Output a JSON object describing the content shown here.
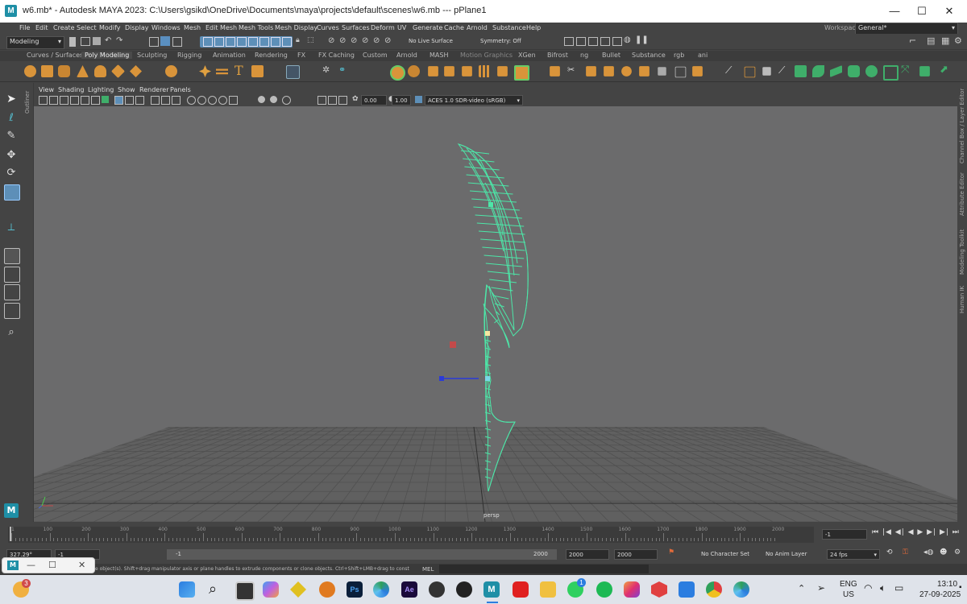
{
  "window": {
    "title": "w6.mb* - Autodesk MAYA 2023: C:\\Users\\gsikd\\OneDrive\\Documents\\maya\\projects\\default\\scenes\\w6.mb   ---   pPlane1",
    "logo": "M",
    "minimize": "—",
    "maximize": "☐",
    "close": "✕"
  },
  "menus": [
    "File",
    "Edit",
    "Create",
    "Select",
    "Modify",
    "Display",
    "Windows",
    "Mesh",
    "Edit Mesh",
    "Mesh Tools",
    "Mesh Display",
    "Curves",
    "Surfaces",
    "Deform",
    "UV",
    "Generate",
    "Cache",
    "Arnold",
    "Substance",
    "Help"
  ],
  "workspace": {
    "label": "Workspace:",
    "value": "General*"
  },
  "status": {
    "mode": "Modeling",
    "live_surface": "No Live Surface",
    "symmetry": "Symmetry: Off"
  },
  "shelf_tabs": [
    "Curves / Surfaces",
    "Poly Modeling",
    "Sculpting",
    "Rigging",
    "Animation",
    "Rendering",
    "FX",
    "FX Caching",
    "Custom",
    "Arnold",
    "MASH",
    "Motion Graphics",
    "XGen",
    "Bifrost",
    "ng",
    "Bullet",
    "Substance",
    "rgb",
    "ani"
  ],
  "active_shelf_tab": "Poly Modeling",
  "panel_menus": [
    "View",
    "Shading",
    "Lighting",
    "Show",
    "Renderer",
    "Panels"
  ],
  "panel_fields": {
    "exposure": "0.00",
    "gamma": "1.00",
    "colorspace": "ACES 1.0 SDR-video (sRGB)"
  },
  "viewport": {
    "camera_label": "persp"
  },
  "side_labels": {
    "left": "Outliner",
    "right": [
      "Channel Box / Layer Editor",
      "Attribute Editor",
      "Modeling Toolkit",
      "Human IK"
    ]
  },
  "timeline": {
    "ticks": [
      "1",
      "100",
      "200",
      "300",
      "400",
      "500",
      "600",
      "700",
      "800",
      "900",
      "1000",
      "1100",
      "1200",
      "1300",
      "1400",
      "1500",
      "1600",
      "1700",
      "1800",
      "1900",
      "2000"
    ],
    "current_frame": "-1",
    "range_start": "327.29°",
    "range_field": "-1",
    "slider_start": "-1",
    "slider_end": "2000",
    "end1": "2000",
    "end2": "2000",
    "character_set": "No Character Set",
    "anim_layer": "No Anim Layer",
    "fps": "24 fps"
  },
  "helpline": {
    "text": "e object(s). Shift+drag manipulator axis or plane handles to extrude components or clone objects. Ctrl+Shift+LMB+drag to constrain scaling to",
    "mel": "MEL"
  },
  "taskbar": {
    "weather_badge": "3",
    "lang1": "ENG",
    "lang2": "US",
    "time": "13:10",
    "date": "27-09-2025",
    "whatsapp_badge": "1"
  },
  "popup": {
    "minimize": "—",
    "restore": "☐",
    "close": "✕"
  },
  "colors": {
    "wire": "#4de6a8",
    "viewport_bg": "#6b6b6c",
    "accent": "#1f8fa6"
  }
}
